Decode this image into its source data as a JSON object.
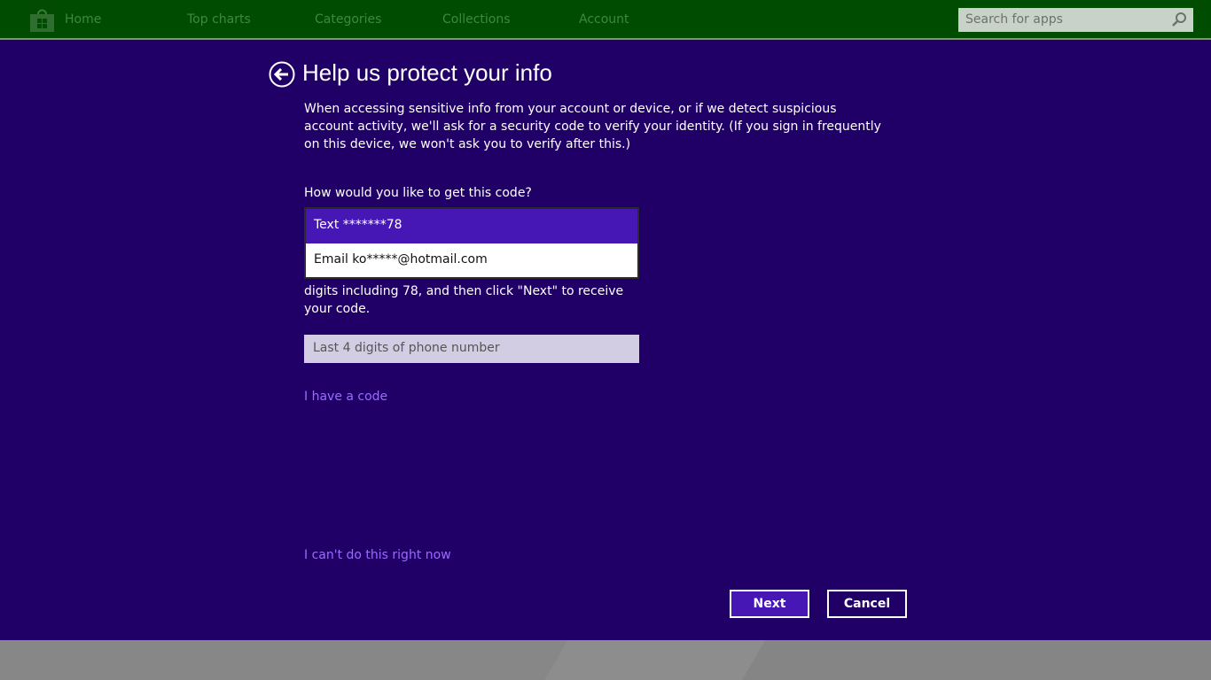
{
  "nav": {
    "items": [
      "Home",
      "Top charts",
      "Categories",
      "Collections",
      "Account"
    ],
    "search_placeholder": "Search for apps"
  },
  "page": {
    "title": "Help us protect your info",
    "intro": "When accessing sensitive info from your account or device, or if we detect suspicious account activity, we'll ask for a security code to verify your identity. (If you sign in frequently on this device, we won't ask you to verify after this.)",
    "question": "How would you like to get this code?",
    "options": [
      "Text *******78",
      "Email ko*****@hotmail.com"
    ],
    "instruction": "digits including 78, and then click \"Next\" to receive your code.",
    "input_placeholder": "Last 4 digits of phone number",
    "have_code": "I have a code",
    "cant_now": "I can't do this right now",
    "next": "Next",
    "cancel": "Cancel"
  },
  "colors": {
    "topbar": "#004c00",
    "background": "#200066",
    "accent": "#4617b4",
    "link": "#9a6bff"
  }
}
